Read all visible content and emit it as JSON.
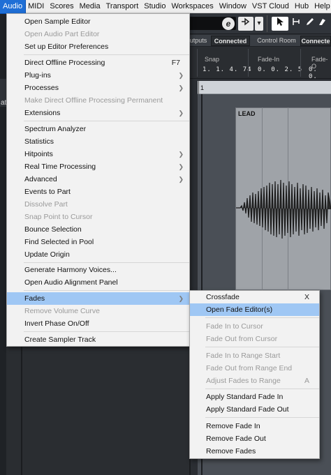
{
  "menubar": {
    "items": [
      "Audio",
      "MIDI",
      "Scores",
      "Media",
      "Transport",
      "Studio",
      "Workspaces",
      "Window",
      "VST Cloud",
      "Hub",
      "Help"
    ],
    "active": "Audio"
  },
  "toolbar": {
    "e_label": "e",
    "play_label": "▾",
    "arrow_label": "▾"
  },
  "connections": {
    "outputs": "utputs",
    "connected1": "Connected",
    "control_room": "Control Room",
    "connected2": "Connecte"
  },
  "info": {
    "snap_label": "Snap",
    "snap_value": "1. 1. 4. 74",
    "fadein_label": "Fade-In",
    "fadein_value": "0. 0. 2.  5",
    "fadeout_label": "Fade-O",
    "fadeout_value": "0. 0."
  },
  "ruler": {
    "marker": "1"
  },
  "clip": {
    "name": "LEAD"
  },
  "left_panel": {
    "text": "at"
  },
  "audio_menu": {
    "items": [
      {
        "label": "Open Sample Editor",
        "disabled": false
      },
      {
        "label": "Open Audio Part Editor",
        "disabled": true
      },
      {
        "label": "Set up Editor Preferences",
        "disabled": false
      },
      {
        "label": "Direct Offline Processing",
        "shortcut": "F7"
      },
      {
        "label": "Plug-ins",
        "submenu": true
      },
      {
        "label": "Processes",
        "submenu": true
      },
      {
        "label": "Make Direct Offline Processing Permanent",
        "disabled": true
      },
      {
        "label": "Extensions",
        "submenu": true
      },
      {
        "label": "Spectrum Analyzer"
      },
      {
        "label": "Statistics"
      },
      {
        "label": "Hitpoints",
        "submenu": true
      },
      {
        "label": "Real Time Processing",
        "submenu": true
      },
      {
        "label": "Advanced",
        "submenu": true
      },
      {
        "label": "Events to Part"
      },
      {
        "label": "Dissolve Part",
        "disabled": true
      },
      {
        "label": "Snap Point to Cursor",
        "disabled": true
      },
      {
        "label": "Bounce Selection"
      },
      {
        "label": "Find Selected in Pool"
      },
      {
        "label": "Update Origin"
      },
      {
        "label": "Generate Harmony Voices..."
      },
      {
        "label": "Open Audio Alignment Panel"
      },
      {
        "label": "Fades",
        "submenu": true,
        "highlighted": true
      },
      {
        "label": "Remove Volume Curve",
        "disabled": true
      },
      {
        "label": "Invert Phase On/Off"
      },
      {
        "label": "Create Sampler Track"
      }
    ]
  },
  "fades_menu": {
    "items": [
      {
        "label": "Crossfade",
        "shortcut": "X"
      },
      {
        "label": "Open Fade Editor(s)",
        "highlighted": true
      },
      {
        "label": "Fade In to Cursor",
        "disabled": true
      },
      {
        "label": "Fade Out from Cursor",
        "disabled": true
      },
      {
        "label": "Fade In to Range Start",
        "disabled": true
      },
      {
        "label": "Fade Out from Range End",
        "disabled": true
      },
      {
        "label": "Adjust Fades to Range",
        "shortcut": "A",
        "disabled": true
      },
      {
        "label": "Apply Standard Fade In"
      },
      {
        "label": "Apply Standard Fade Out"
      },
      {
        "label": "Remove Fade In"
      },
      {
        "label": "Remove Fade Out"
      },
      {
        "label": "Remove Fades"
      }
    ]
  },
  "colors": {
    "menu_bg": "#f2f2f2",
    "highlight": "#9fc7f4",
    "active_menu": "#1f6fd6"
  }
}
